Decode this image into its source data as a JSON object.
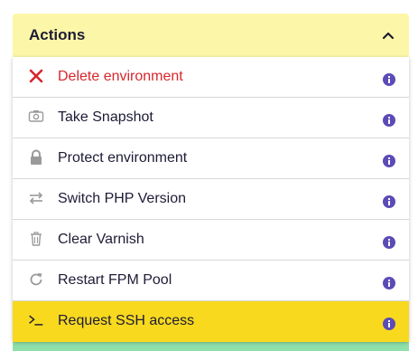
{
  "panel": {
    "title": "Actions",
    "header_bg": "#fcf7a8",
    "chevron_icon": "chevron-up-icon"
  },
  "menu": {
    "items": [
      {
        "label": "Delete environment",
        "icon": "close-x-icon",
        "danger": true
      },
      {
        "label": "Take Snapshot",
        "icon": "camera-icon"
      },
      {
        "label": "Protect environment",
        "icon": "lock-icon"
      },
      {
        "label": "Switch PHP Version",
        "icon": "swap-arrows-icon"
      },
      {
        "label": "Clear Varnish",
        "icon": "trash-icon"
      },
      {
        "label": "Restart FPM Pool",
        "icon": "restart-icon"
      },
      {
        "label": "Request SSH access",
        "icon": "terminal-icon",
        "highlighted": true
      }
    ],
    "info_icon": "info-icon"
  },
  "colors": {
    "text": "#1d1c35",
    "danger": "#d7262d",
    "highlight": "#f8d91e",
    "info": "#5b4bb7",
    "icon_gray": "#9a9a9a"
  }
}
